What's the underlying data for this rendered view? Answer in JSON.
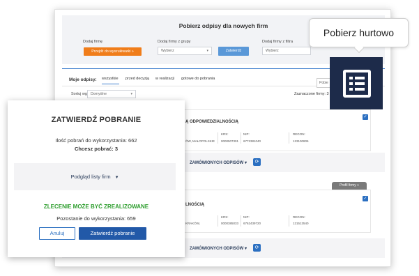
{
  "app": {
    "panel_title": "Pobierz odpisy dla nowych firm",
    "add_company_label": "Dodaj firmę",
    "go_to_search_button": "Przejdź do wyszukiwarki »",
    "add_from_group_label": "Dodaj firmy z grupy",
    "group_select_value": "Wybierz",
    "approve_button": "Zatwierdź",
    "add_from_filter_label": "Dodaj firmy z filtra",
    "filter_select_value": "Wybierz",
    "my_documents_label": "Moje odpisy:",
    "tabs": [
      {
        "label": "wszystkie"
      },
      {
        "label": "przed decyzją"
      },
      {
        "label": "w realizacji"
      },
      {
        "label": "gotowe do pobrania"
      }
    ],
    "sort_label": "Sortuj wg:",
    "sort_value": "Domyślne",
    "selected_companies": "Zaznaczone firmy: 3",
    "ghost_button": "Pobie",
    "profile_tag": "Profil firmy »",
    "cards": [
      {
        "company_fragment": "Ą ODPOWIEDZIALNOŚCIĄ",
        "location_fragment": "ÓW, MAŁOPOLSKIE",
        "krs_label": "KRS:",
        "krs_value": "0000507301",
        "nip_label": "NIP:",
        "nip_value": "6772381040",
        "regon_label": "REGON:",
        "regon_value": "123100806",
        "orders_fragment": "ZAMÓWIONYCH ODPISÓW"
      },
      {
        "company_fragment": "LNOŚCIĄ",
        "location_fragment": "KRAKÓW,",
        "krs_label": "KRS:",
        "krs_value": "0000385033",
        "nip_label": "NIP:",
        "nip_value": "6762439720",
        "regon_label": "REGON:",
        "regon_value": "121513540",
        "orders_fragment": "ZAMÓWIONYCH ODPISÓW"
      }
    ]
  },
  "tooltip": {
    "text": "Pobierz hurtowo",
    "icon": "list-icon"
  },
  "modal": {
    "title": "ZATWIERDŹ POBRANIE",
    "available_downloads": "Ilość pobrań do wykorzystania: 662",
    "want_to_download": "Chcesz pobrać: 3",
    "preview_label": "Podgląd listy firm",
    "success_message": "ZLECENIE MOŻE BYĆ ZREALIZOWANE",
    "remaining": "Pozostanie do wykorzystania: 659",
    "cancel_button": "Anuluj",
    "confirm_button": "Zatwierdź pobranie"
  },
  "colors": {
    "accent_blue": "#2259a8",
    "orange": "#f07d1a",
    "success_green": "#2e9e2e",
    "dark_navy": "#1d2b4a"
  }
}
